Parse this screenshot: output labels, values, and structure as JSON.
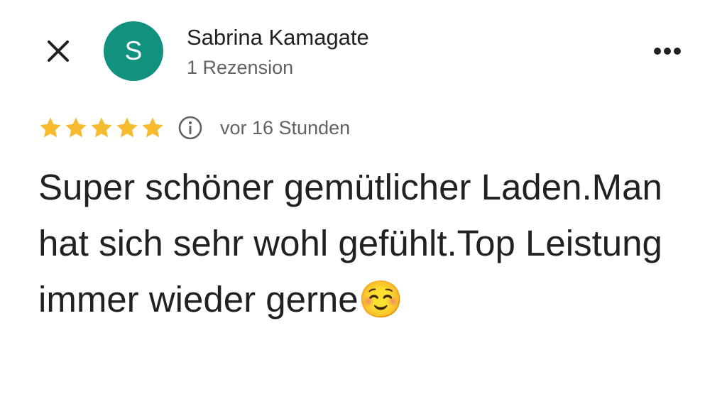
{
  "header": {
    "avatar_letter": "S",
    "avatar_color": "#12917f",
    "author_name": "Sabrina Kamagate",
    "author_meta": "1 Rezension",
    "close_icon": "close-icon",
    "more_icon": "more-horizontal-icon"
  },
  "rating": {
    "stars": 5,
    "max_stars": 5,
    "star_color": "#f6bb2e",
    "info_icon": "info-icon",
    "time": "vor 16 Stunden"
  },
  "review": {
    "text": "Super schöner gemütlicher Laden.Man hat sich sehr wohl gefühlt.Top Leistung immer wieder gerne☺️"
  }
}
